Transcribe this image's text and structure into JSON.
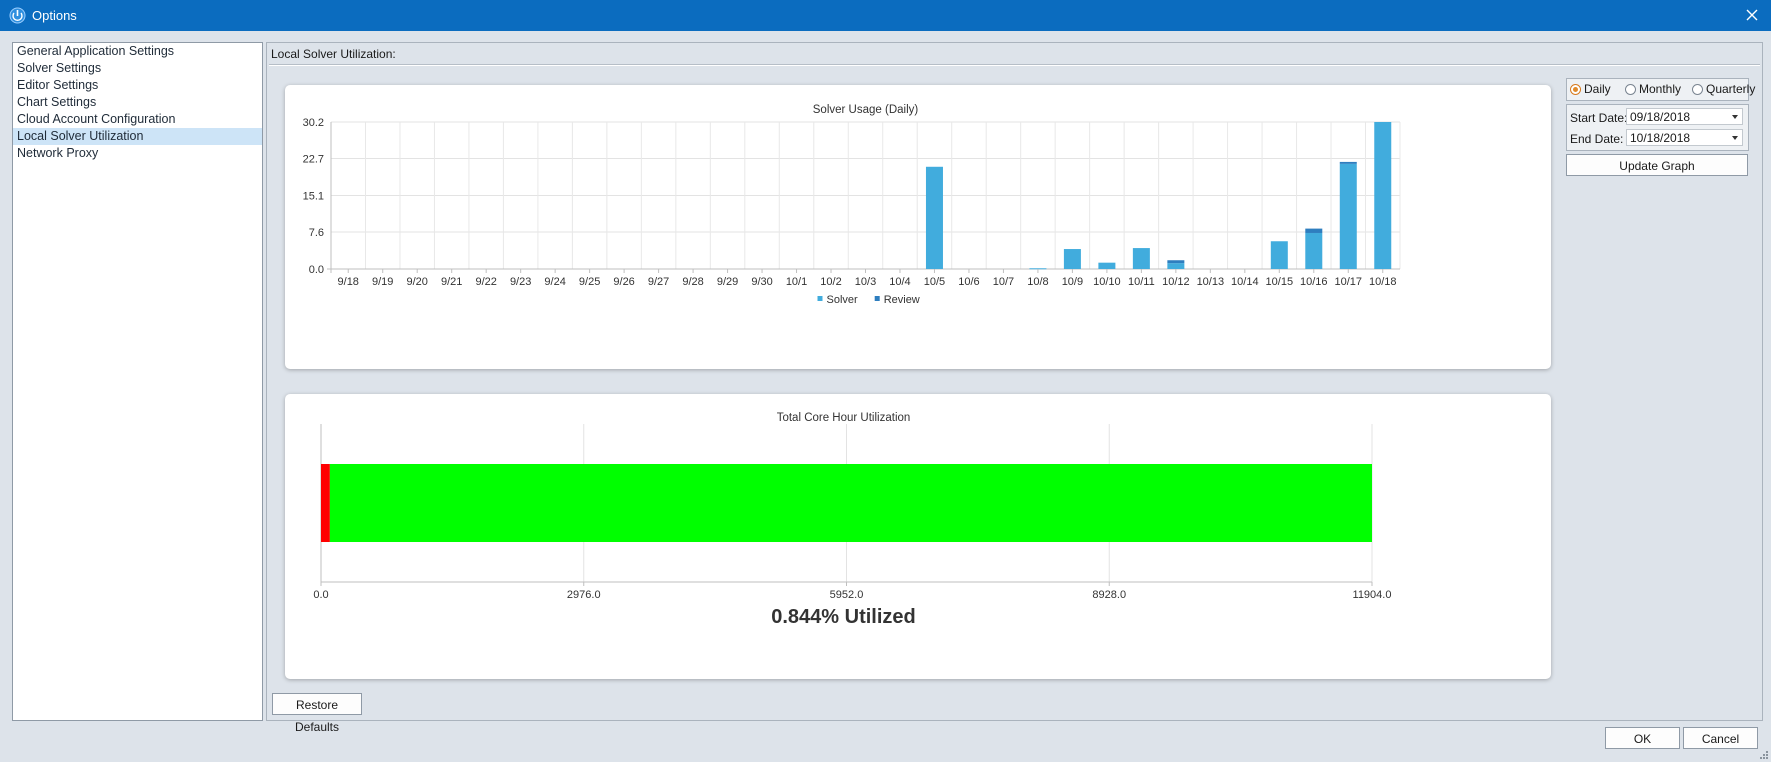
{
  "window": {
    "title": "Options",
    "accent": "#0b6cbf"
  },
  "nav": {
    "items": [
      {
        "label": "General Application Settings",
        "selected": false
      },
      {
        "label": "Solver Settings",
        "selected": false
      },
      {
        "label": "Editor Settings",
        "selected": false
      },
      {
        "label": "Chart Settings",
        "selected": false
      },
      {
        "label": "Cloud Account Configuration",
        "selected": false
      },
      {
        "label": "Local Solver Utilization",
        "selected": true
      },
      {
        "label": "Network Proxy",
        "selected": false
      }
    ]
  },
  "section": {
    "title": "Local Solver Utilization:"
  },
  "controls": {
    "period_options": [
      {
        "label": "Daily",
        "checked": true
      },
      {
        "label": "Monthly",
        "checked": false
      },
      {
        "label": "Quarterly",
        "checked": false
      }
    ],
    "start_date_label": "Start Date:",
    "start_date_value": "09/18/2018",
    "end_date_label": "End Date:",
    "end_date_value": "10/18/2018",
    "update_label": "Update Graph"
  },
  "chart_data": [
    {
      "type": "bar",
      "stacked": true,
      "title": "Solver Usage (Daily)",
      "xlabel": "",
      "ylabel": "",
      "ylim": [
        0,
        30.2
      ],
      "yticks": [
        "0.0",
        "7.6",
        "15.1",
        "22.7",
        "30.2"
      ],
      "grid": true,
      "legend": "bottom",
      "categories": [
        "9/18",
        "9/19",
        "9/20",
        "9/21",
        "9/22",
        "9/23",
        "9/24",
        "9/25",
        "9/26",
        "9/27",
        "9/28",
        "9/29",
        "9/30",
        "10/1",
        "10/2",
        "10/3",
        "10/4",
        "10/5",
        "10/6",
        "10/7",
        "10/8",
        "10/9",
        "10/10",
        "10/11",
        "10/12",
        "10/13",
        "10/14",
        "10/15",
        "10/16",
        "10/17",
        "10/18"
      ],
      "series": [
        {
          "name": "Solver",
          "color": "#41acdd",
          "values": [
            0,
            0,
            0,
            0,
            0,
            0,
            0,
            0,
            0,
            0,
            0,
            0,
            0,
            0,
            0,
            0,
            0,
            21.0,
            0,
            0,
            0.15,
            4.1,
            1.3,
            4.3,
            1.2,
            0,
            0,
            5.7,
            7.4,
            21.6,
            30.2
          ]
        },
        {
          "name": "Review",
          "color": "#2e7ebf",
          "values": [
            0,
            0,
            0,
            0,
            0,
            0,
            0,
            0,
            0,
            0,
            0,
            0,
            0,
            0,
            0,
            0,
            0,
            0,
            0,
            0,
            0,
            0,
            0,
            0,
            0.6,
            0,
            0,
            0,
            0.9,
            0.4,
            0
          ]
        }
      ]
    },
    {
      "type": "bar",
      "orientation": "horizontal",
      "stacked": true,
      "title": "Total Core Hour Utilization",
      "xlim": [
        0,
        11904
      ],
      "xticks": [
        "0.0",
        "2976.0",
        "5952.0",
        "8928.0",
        "11904.0"
      ],
      "grid": true,
      "series": [
        {
          "color": "#ff0000",
          "values": [
            100.5
          ]
        },
        {
          "color": "#00ff00",
          "values": [
            11803.5
          ]
        }
      ],
      "annotation": "0.844% Utilized"
    }
  ],
  "footer": {
    "restore_label": "Restore Defaults",
    "ok_label": "OK",
    "cancel_label": "Cancel"
  }
}
